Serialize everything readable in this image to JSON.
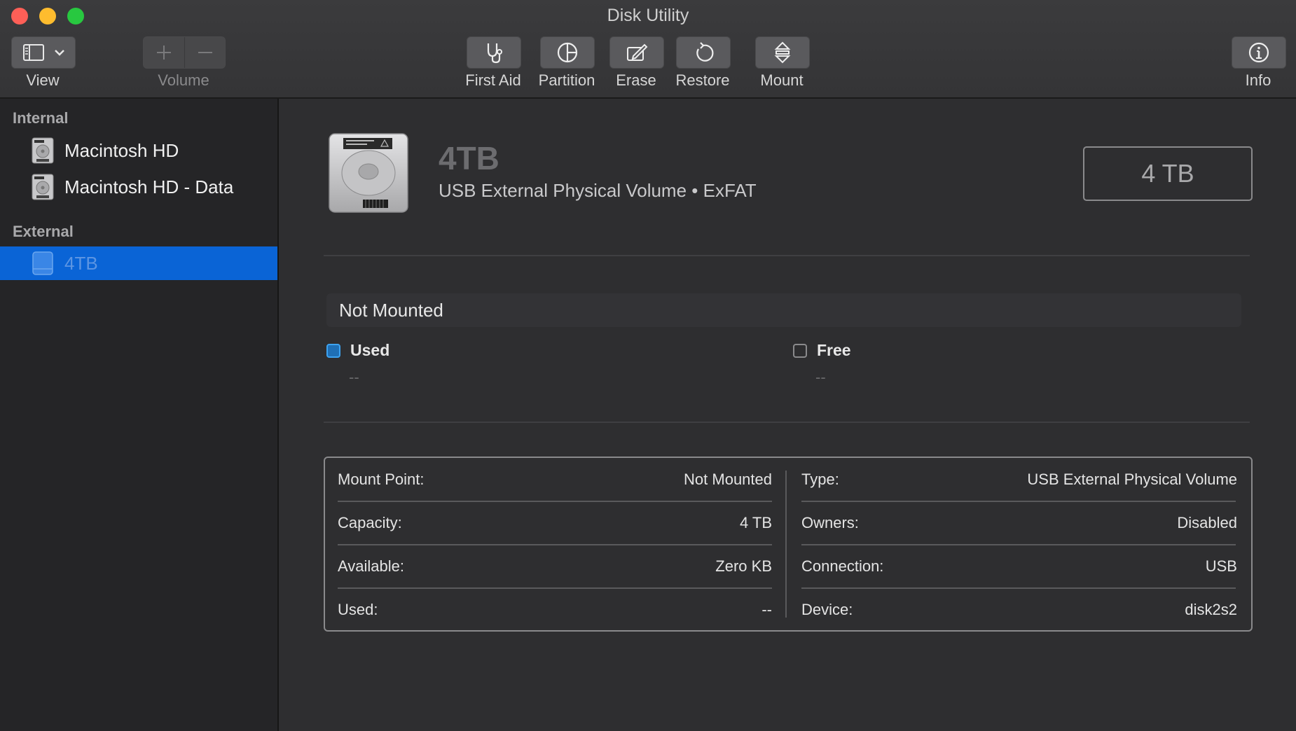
{
  "window": {
    "title": "Disk Utility"
  },
  "toolbar": {
    "view_label": "View",
    "volume_label": "Volume",
    "first_aid_label": "First Aid",
    "partition_label": "Partition",
    "erase_label": "Erase",
    "restore_label": "Restore",
    "mount_label": "Mount",
    "info_label": "Info"
  },
  "sidebar": {
    "internal_header": "Internal",
    "external_header": "External",
    "items": [
      {
        "label": "Macintosh HD",
        "section": "internal"
      },
      {
        "label": "Macintosh HD - Data",
        "section": "internal"
      },
      {
        "label": "4TB",
        "section": "external",
        "selected": true
      }
    ]
  },
  "volume": {
    "name": "4TB",
    "subtitle": "USB External Physical Volume • ExFAT",
    "capacity_display": "4 TB",
    "mount_status": "Not Mounted"
  },
  "usage": {
    "used_label": "Used",
    "used_value": "--",
    "free_label": "Free",
    "free_value": "--"
  },
  "details": {
    "left": [
      {
        "key": "Mount Point:",
        "value": "Not Mounted"
      },
      {
        "key": "Capacity:",
        "value": "4 TB"
      },
      {
        "key": "Available:",
        "value": "Zero KB"
      },
      {
        "key": "Used:",
        "value": "--"
      }
    ],
    "right": [
      {
        "key": "Type:",
        "value": "USB External Physical Volume"
      },
      {
        "key": "Owners:",
        "value": "Disabled"
      },
      {
        "key": "Connection:",
        "value": "USB"
      },
      {
        "key": "Device:",
        "value": "disk2s2"
      }
    ]
  },
  "colors": {
    "selection": "#0a64d6",
    "used_swatch": "#3da3f1",
    "close": "#fe5f57",
    "minimize": "#febc2e",
    "zoom": "#28c840"
  }
}
